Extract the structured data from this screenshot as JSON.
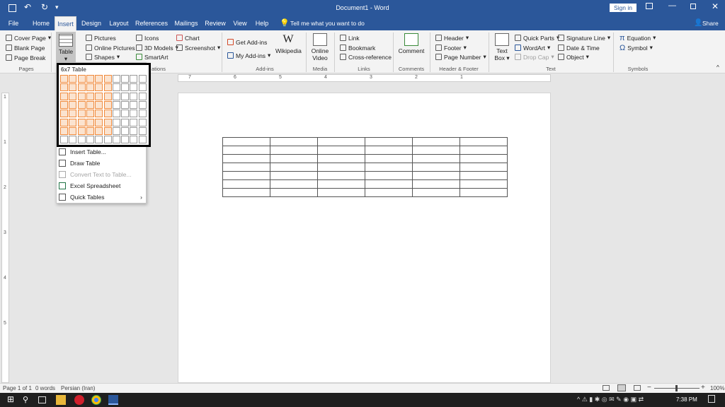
{
  "window": {
    "title": "Document1 - Word",
    "sign_in": "Sign in",
    "share": "Share"
  },
  "tabs": [
    "File",
    "Home",
    "Insert",
    "Design",
    "Layout",
    "References",
    "Mailings",
    "Review",
    "View",
    "Help"
  ],
  "tell_me": "Tell me what you want to do",
  "ribbon": {
    "pages": {
      "cover": "Cover Page",
      "blank": "Blank Page",
      "break": "Page Break",
      "label": "Pages"
    },
    "table": {
      "label": "Table"
    },
    "illustrations": {
      "pictures": "Pictures",
      "online_pictures": "Online Pictures",
      "shapes": "Shapes",
      "icons": "Icons",
      "models3d": "3D Models",
      "smartart": "SmartArt",
      "chart": "Chart",
      "screenshot": "Screenshot",
      "label": "ations"
    },
    "addins": {
      "get": "Get Add-ins",
      "my": "My Add-ins",
      "wikipedia": "Wikipedia",
      "label": "Add-ins"
    },
    "media": {
      "online_video_1": "Online",
      "online_video_2": "Video",
      "label": "Media"
    },
    "links": {
      "link": "Link",
      "bookmark": "Bookmark",
      "crossref": "Cross-reference",
      "label": "Links"
    },
    "comments": {
      "comment": "Comment",
      "label": "Comments"
    },
    "header_footer": {
      "header": "Header",
      "footer": "Footer",
      "page_number": "Page Number",
      "label": "Header & Footer"
    },
    "text": {
      "textbox_1": "Text",
      "textbox_2": "Box",
      "quick_parts": "Quick Parts",
      "wordart": "WordArt",
      "drop_cap": "Drop Cap",
      "signature": "Signature Line",
      "datetime": "Date & Time",
      "object": "Object",
      "label": "Text"
    },
    "symbols": {
      "equation": "Equation",
      "symbol": "Symbol",
      "label": "Symbols"
    }
  },
  "table_menu": {
    "heading": "6x7 Table",
    "cols_selected": 6,
    "rows_selected": 7,
    "grid_cols": 10,
    "grid_rows": 8,
    "items": [
      "Insert Table...",
      "Draw Table",
      "Convert Text to Table...",
      "Excel Spreadsheet",
      "Quick Tables"
    ]
  },
  "ruler_marks": [
    "7",
    "6",
    "5",
    "4",
    "3",
    "2",
    "1"
  ],
  "vruler_marks": [
    "1",
    "1",
    "2",
    "3",
    "4",
    "5"
  ],
  "doc_table": {
    "rows": 7,
    "cols": 6
  },
  "status": {
    "page": "Page 1 of 1",
    "words": "0 words",
    "language": "Persian (Iran)",
    "zoom": "100%"
  },
  "taskbar": {
    "time": "7:38 PM"
  },
  "colors": {
    "brand": "#2b579a",
    "grid_selected": "#f08a3c"
  }
}
